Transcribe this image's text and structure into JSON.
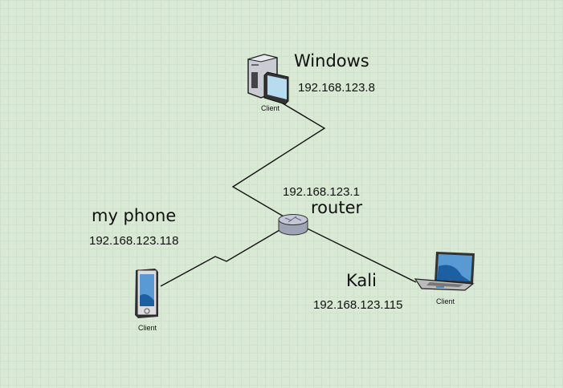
{
  "nodes": {
    "windows": {
      "name": "Windows",
      "ip": "192.168.123.8",
      "caption": "Client",
      "icon": "desktop-pc-icon"
    },
    "router": {
      "name": "router",
      "ip": "192.168.123.1",
      "icon": "router-icon"
    },
    "phone": {
      "name": "my phone",
      "ip": "192.168.123.118",
      "caption": "Client",
      "icon": "smartphone-icon"
    },
    "kali": {
      "name": "Kali",
      "ip": "192.168.123.115",
      "caption": "Client",
      "icon": "laptop-icon"
    }
  },
  "colors": {
    "background": "#dae8d6",
    "wire": "#111111",
    "screen": "#3f86c6"
  }
}
